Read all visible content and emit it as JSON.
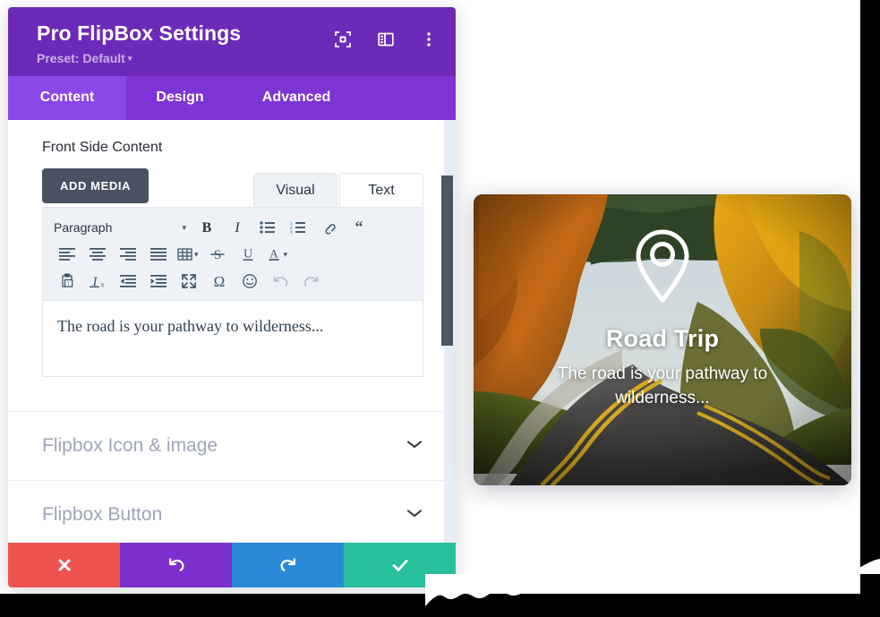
{
  "panel": {
    "title": "Pro FlipBox Settings",
    "preset_label": "Preset: Default",
    "preset_caret": "▾",
    "icons": [
      {
        "name": "focus-target-icon",
        "label": "focus-target-icon"
      },
      {
        "name": "layout-panel-icon",
        "label": "layout-panel-icon"
      },
      {
        "name": "more-vertical-icon",
        "label": "more-vertical-icon"
      }
    ],
    "tabs": [
      {
        "label": "Content",
        "active": true
      },
      {
        "label": "Design",
        "active": false
      },
      {
        "label": "Advanced",
        "active": false
      }
    ]
  },
  "content": {
    "front_side_label": "Front Side Content",
    "add_media_label": "ADD MEDIA",
    "editor_tabs": [
      {
        "label": "Visual",
        "active": true
      },
      {
        "label": "Text",
        "active": false
      }
    ],
    "editor_toolbar": {
      "paragraph_select": "Paragraph",
      "caret": "▾",
      "row1": [
        "bold-icon",
        "italic-icon",
        "bullet-list-icon",
        "numbered-list-icon",
        "link-icon",
        "blockquote-icon"
      ],
      "row2": [
        "align-left-icon",
        "align-center-icon",
        "align-right-icon",
        "align-justify-icon",
        "table-icon",
        "strikethrough-icon",
        "underline-icon",
        "text-color-icon"
      ],
      "row3": [
        "paste-as-text-icon",
        "clear-formatting-icon",
        "outdent-icon",
        "indent-icon",
        "fullscreen-icon",
        "special-character-icon",
        "emoji-icon",
        "undo-icon",
        "redo-icon"
      ],
      "special_character_glyph": "Ω"
    },
    "editor_text": "The road is your pathway to wilderness...",
    "accordion": [
      {
        "label": "Flipbox Icon & image",
        "chevron": "⌄"
      },
      {
        "label": "Flipbox Button",
        "chevron": "⌄"
      }
    ]
  },
  "actions": [
    {
      "name": "cancel-button",
      "icon": "close-icon",
      "color": "#ef5350"
    },
    {
      "name": "undo-button",
      "icon": "undo-icon",
      "color": "#7c30cd"
    },
    {
      "name": "redo-button",
      "icon": "redo-icon",
      "color": "#2b8ad8"
    },
    {
      "name": "save-button",
      "icon": "check-icon",
      "color": "#27bf9c"
    }
  ],
  "preview": {
    "icon": "map-pin-icon",
    "title": "Road Trip",
    "description": "The road is your pathway to wilderness..."
  },
  "colors": {
    "header_purple": "#6d2ab8",
    "tabbar_purple": "#7e34d4",
    "tab_active_purple": "#8d46e8",
    "add_media_slate": "#495263",
    "toolbar_bg": "#eef2f7"
  }
}
